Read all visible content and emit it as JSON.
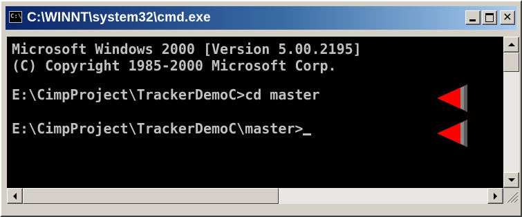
{
  "window": {
    "title": "C:\\WINNT\\system32\\cmd.exe",
    "icon": "console-window-icon",
    "icon_glyph": "C:\\",
    "controls": {
      "minimize": "minimize-icon",
      "maximize": "maximize-icon",
      "close": "close-icon",
      "close_glyph": "✕"
    }
  },
  "console": {
    "lines": [
      "Microsoft Windows 2000 [Version 5.00.2195]",
      "(C) Copyright 1985-2000 Microsoft Corp.",
      "E:\\CimpProject\\TrackerDemoC>cd master",
      "E:\\CimpProject\\TrackerDemoC\\master>"
    ],
    "text_color": "#c0c0c0",
    "background": "#000000",
    "cursor_shown": true
  },
  "annotations": {
    "marker_icon": "red-arrow-pointer-icon",
    "marker_color": "#ff0000",
    "count": 2
  },
  "scrollbars": {
    "vertical": {
      "up": "scroll-up-arrow-icon",
      "down": "scroll-down-arrow-icon"
    },
    "horizontal": {
      "left": "scroll-left-arrow-icon",
      "right": "scroll-right-arrow-icon"
    }
  },
  "colors": {
    "title_gradient_start": "#0a246a",
    "title_gradient_end": "#a6caf0",
    "chrome": "#d4d0c8"
  }
}
